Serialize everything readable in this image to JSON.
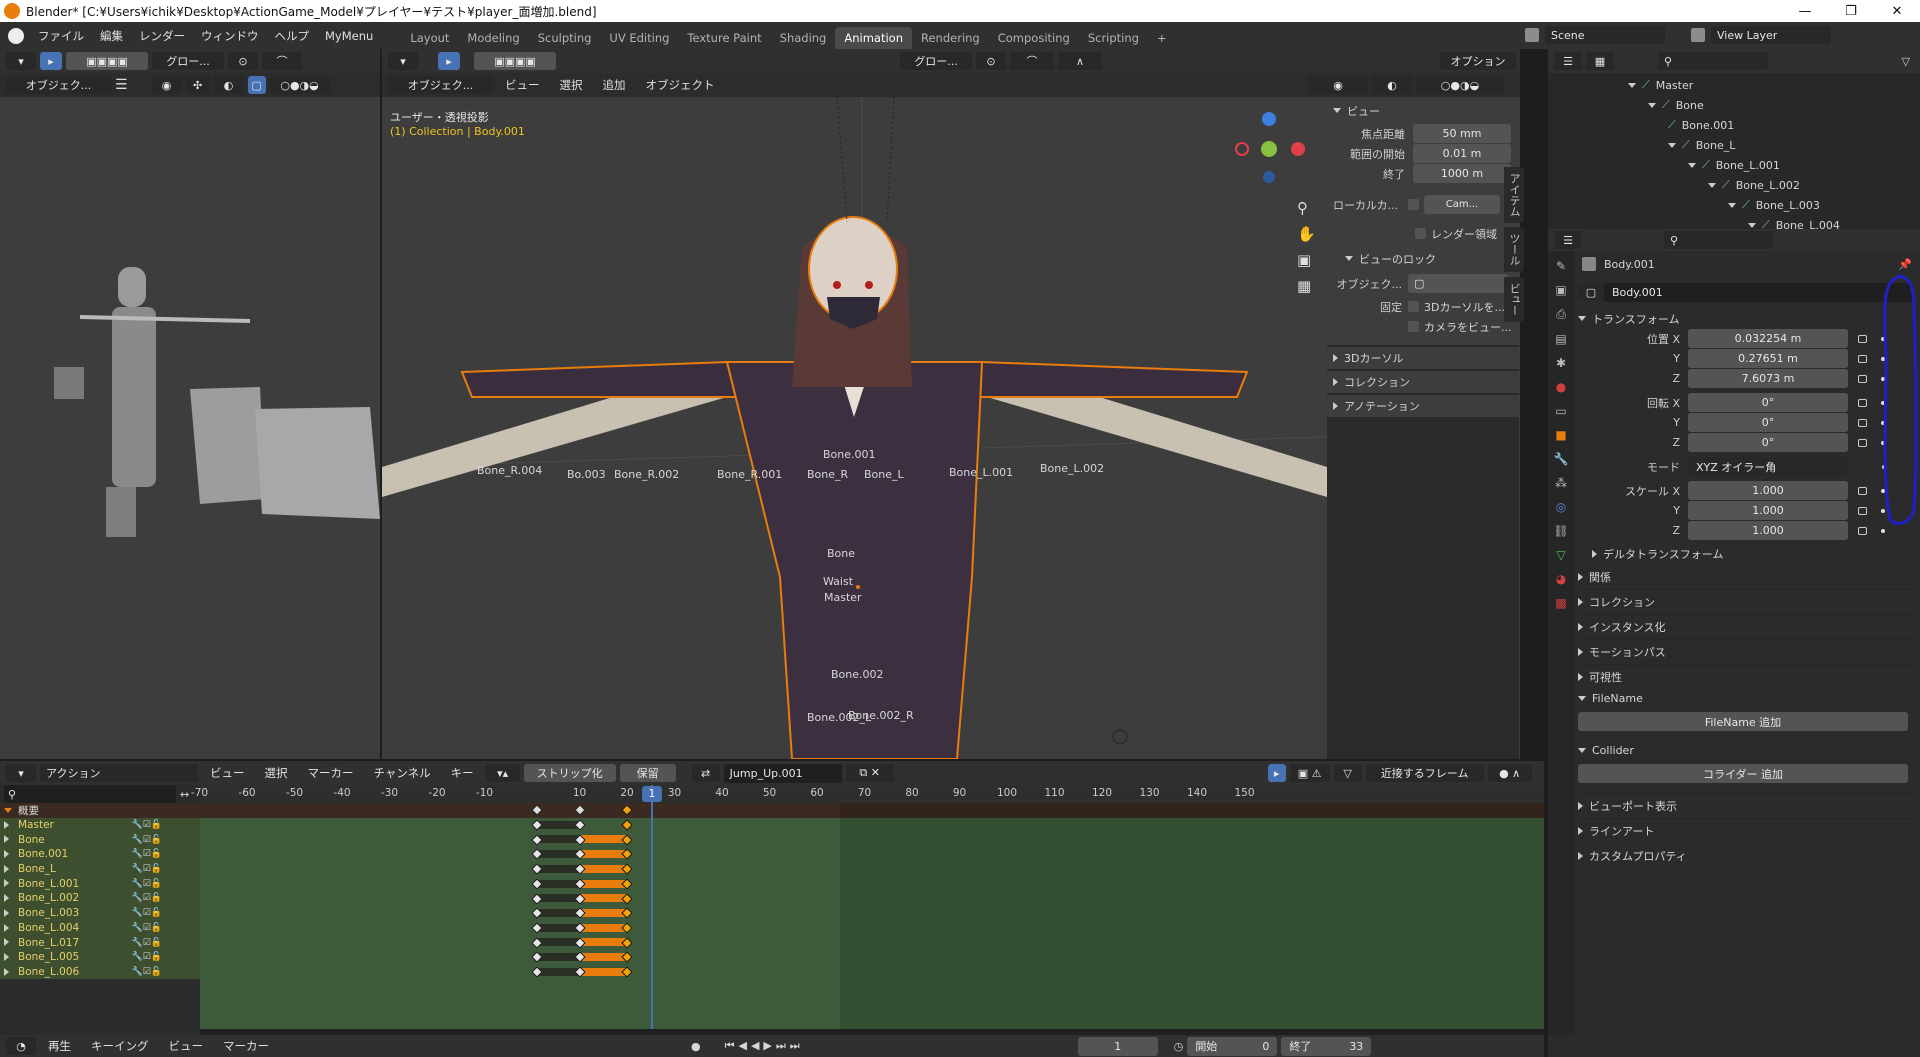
{
  "window": {
    "title": "Blender* [C:¥Users¥ichik¥Desktop¥ActionGame_Model¥プレイヤー¥テスト¥player_面増加.blend]",
    "minimize": "—",
    "maximize": "❐",
    "close": "✕"
  },
  "menubar": {
    "items": [
      "ファイル",
      "編集",
      "レンダー",
      "ウィンドウ",
      "ヘルプ",
      "MyMenu"
    ]
  },
  "workspaces": {
    "tabs": [
      "Layout",
      "Modeling",
      "Sculpting",
      "UV Editing",
      "Texture Paint",
      "Shading",
      "Animation",
      "Rendering",
      "Compositing",
      "Scripting"
    ],
    "active": "Animation",
    "add": "+"
  },
  "scene": {
    "label": "Scene",
    "view_layer": "View Layer"
  },
  "left_view": {
    "mode": "オブジェク...",
    "transform": "グロー..."
  },
  "main_view": {
    "mode": "オブジェク...",
    "menus": [
      "ビュー",
      "選択",
      "追加",
      "オブジェクト"
    ],
    "overlay_title": "ユーザー・透視投影",
    "overlay_sub": "(1) Collection | Body.001",
    "transform": "グロー...",
    "options": "オプション"
  },
  "bones": [
    {
      "t": "Bone.001"
    },
    {
      "t": "Bone_R.002"
    },
    {
      "t": "Bone_R.001"
    },
    {
      "t": "Bone_R"
    },
    {
      "t": "Bone_L"
    },
    {
      "t": "Bone_L.001"
    },
    {
      "t": "Bone_L.002"
    },
    {
      "t": "Bone"
    },
    {
      "t": "Waist"
    },
    {
      "t": "Master"
    },
    {
      "t": "Bone.002"
    },
    {
      "t": "Bone.002_L"
    },
    {
      "t": "Bone.002_R"
    },
    {
      "t": "Bo.003"
    },
    {
      "t": "Bone_R.004"
    }
  ],
  "npanel": {
    "view_header": "ビュー",
    "focal_label": "焦点距離",
    "focal": "50 mm",
    "clip_start_label": "範囲の開始",
    "clip_start": "0.01 m",
    "clip_end_label": "終了",
    "clip_end": "1000 m",
    "local_cam_label": "ローカルカ...",
    "local_cam": "Cam...",
    "render_region": "レンダー領域",
    "view_lock": "ビューのロック",
    "lock_obj_label": "オブジェク...",
    "lock_label": "固定",
    "lock_cursor": "3Dカーソルを...",
    "lock_camera": "カメラをビュー...",
    "cursor3d": "3Dカーソル",
    "collection": "コレクション",
    "annotation": "アノテーション",
    "tabs": [
      "アイテム",
      "ツール",
      "ビュー"
    ]
  },
  "outliner": {
    "items": [
      {
        "name": "Master",
        "depth": 0
      },
      {
        "name": "Bone",
        "depth": 1
      },
      {
        "name": "Bone.001",
        "depth": 2
      },
      {
        "name": "Bone_L",
        "depth": 2
      },
      {
        "name": "Bone_L.001",
        "depth": 3
      },
      {
        "name": "Bone_L.002",
        "depth": 4
      },
      {
        "name": "Bone_L.003",
        "depth": 5
      },
      {
        "name": "Bone_L.004",
        "depth": 6
      }
    ]
  },
  "properties": {
    "object_name": "Body.001",
    "data_name": "Body.001",
    "transform_header": "トランスフォーム",
    "loc_x_label": "位置 X",
    "loc_x": "0.032254 m",
    "loc_y": "0.27651 m",
    "loc_z": "7.6073 m",
    "rot_x_label": "回転 X",
    "rot_x": "0°",
    "rot_y": "0°",
    "rot_z": "0°",
    "mode_label": "モード",
    "mode": "XYZ オイラー角",
    "scale_x_label": "スケール X",
    "scale_x": "1.000",
    "scale_y": "1.000",
    "scale_z": "1.000",
    "y_label": "Y",
    "z_label": "Z",
    "delta": "デルタトランスフォーム",
    "sections": [
      "関係",
      "コレクション",
      "インスタンス化",
      "モーションパス",
      "可視性"
    ],
    "filename_header": "FileName",
    "filename_btn": "FileName 追加",
    "collider_header": "Collider",
    "collider_btn": "コライダー 追加",
    "sections2": [
      "ビューポート表示",
      "ラインアート",
      "カスタムプロパティ"
    ]
  },
  "dopesheet": {
    "mode": "アクション",
    "menus": [
      "ビュー",
      "選択",
      "マーカー",
      "チャンネル",
      "キー"
    ],
    "push_down": "ストリップ化",
    "stash": "保留",
    "action": "Jump_Up.001",
    "snap": "近接するフレーム",
    "ruler": [
      "-70",
      "-60",
      "-50",
      "-40",
      "-30",
      "-20",
      "-10",
      "1",
      "10",
      "20",
      "30",
      "40",
      "50",
      "60",
      "70",
      "80",
      "90",
      "100",
      "110",
      "120",
      "130",
      "140",
      "150"
    ],
    "current_frame": "1",
    "summary": "概要",
    "channels": [
      "Master",
      "Bone",
      "Bone.001",
      "Bone_L",
      "Bone_L.001",
      "Bone_L.002",
      "Bone_L.003",
      "Bone_L.004",
      "Bone_L.017",
      "Bone_L.005",
      "Bone_L.006"
    ]
  },
  "footer": {
    "menus": [
      "再生",
      "キーイング",
      "ビュー",
      "マーカー"
    ],
    "frame": "1",
    "start_label": "開始",
    "start": "0",
    "end_label": "終了",
    "end": "33"
  },
  "colors": {
    "accent": "#4772b3",
    "selected": "#e87d0d",
    "keyframe": "#f0a30a",
    "panel_bg": "#303030",
    "viewport_bg": "#3d3d3d"
  }
}
